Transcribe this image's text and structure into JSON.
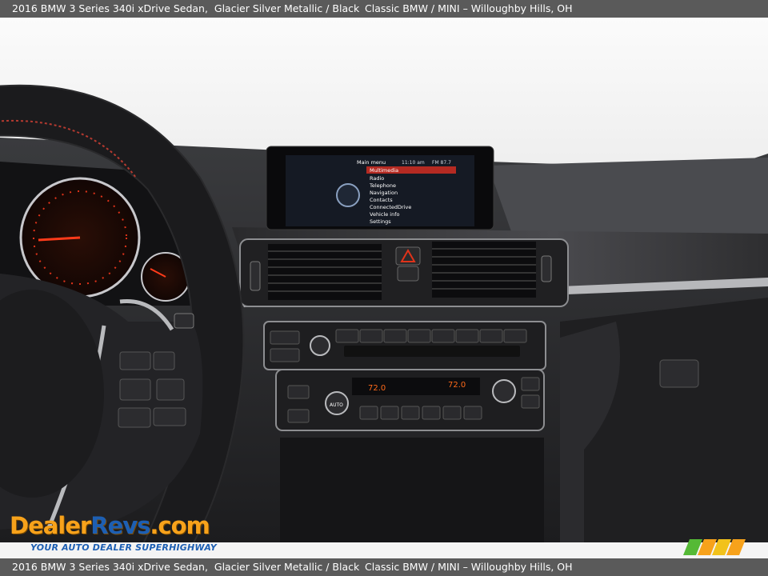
{
  "caption": {
    "vehicle": "2016 BMW 3 Series 340i xDrive Sedan,",
    "colors": "Glacier Silver Metallic  /  Black",
    "dealer": "Classic BMW / MINI – Willoughby Hills, OH"
  },
  "idrive": {
    "header": "Main menu",
    "time": "11:10 am",
    "radio": "FM 87.7",
    "menu": [
      "Multimedia",
      "Radio",
      "Telephone",
      "Navigation",
      "Contacts",
      "ConnectedDrive",
      "Vehicle info",
      "Settings"
    ]
  },
  "climate": {
    "left_temp": "72.0",
    "right_temp": "72.0",
    "fan": "AUTO"
  },
  "watermark": {
    "brand_a": "Dealer",
    "brand_b": "Revs",
    "brand_c": ".com",
    "tagline": "YOUR AUTO DEALER SUPERHIGHWAY"
  },
  "colors": {
    "caption_bar": "#5a5a5a",
    "accent_red": "#e0331a",
    "brand_orange": "#f7a21b",
    "brand_blue": "#1d5fb3"
  }
}
